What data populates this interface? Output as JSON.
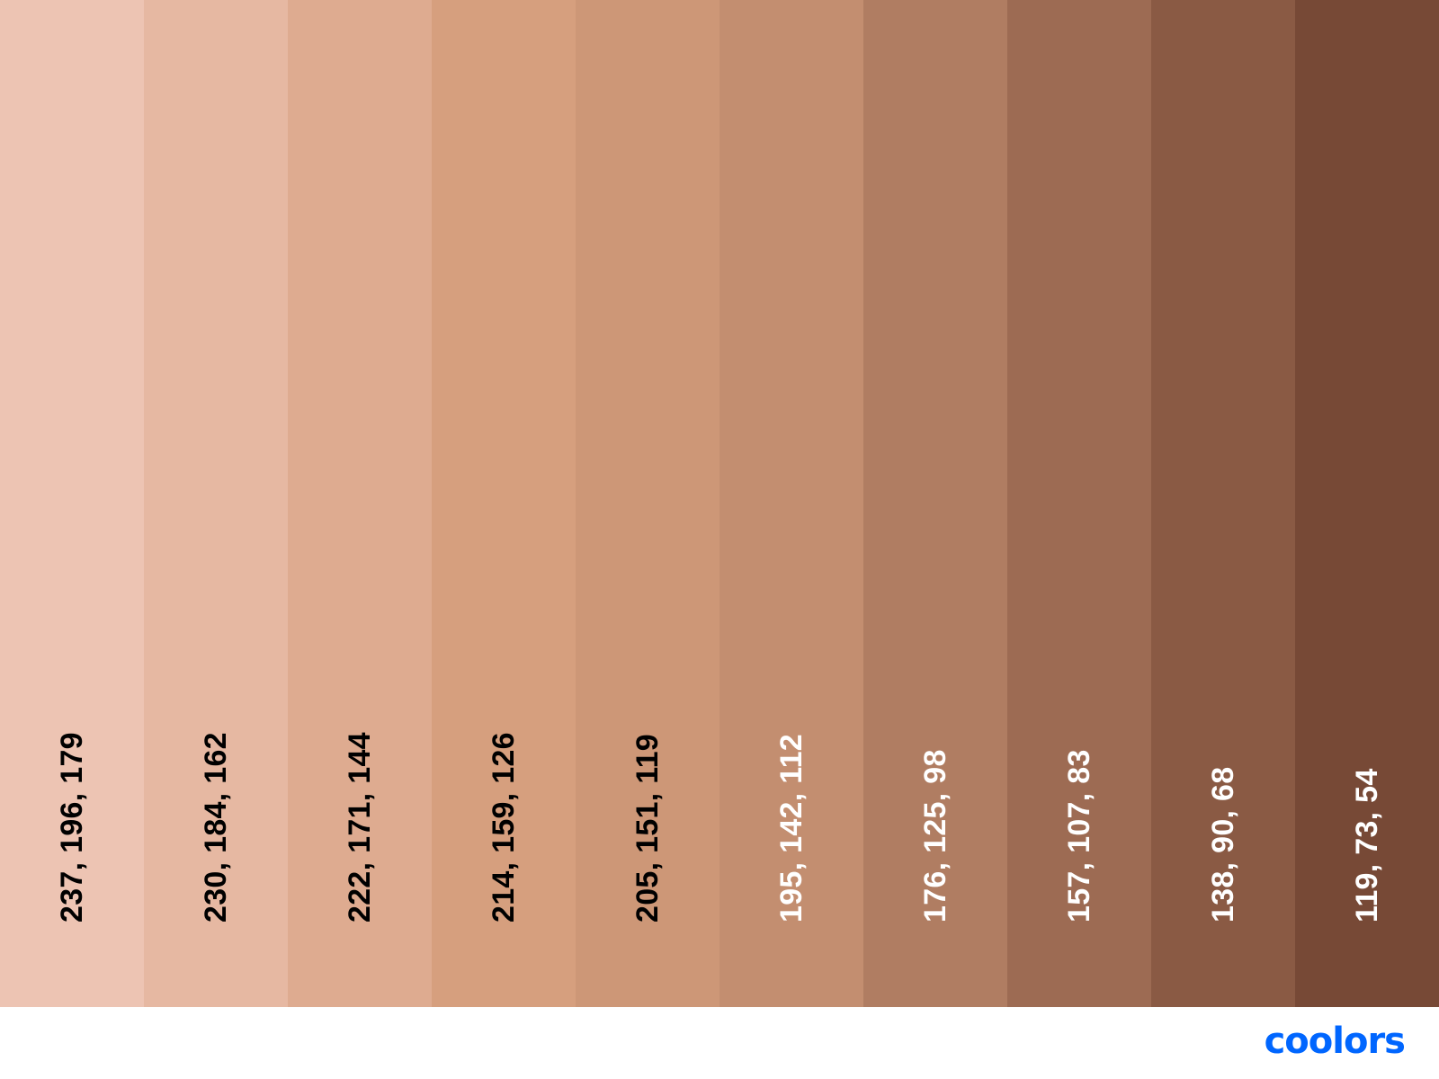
{
  "palette": {
    "swatches": [
      {
        "label": "237, 196, 179",
        "color": "#EDC4B3",
        "text_color": "#000000"
      },
      {
        "label": "230, 184, 162",
        "color": "#E6B8A2",
        "text_color": "#000000"
      },
      {
        "label": "222, 171, 144",
        "color": "#DEAB90",
        "text_color": "#000000"
      },
      {
        "label": "214, 159, 126",
        "color": "#D69F7E",
        "text_color": "#000000"
      },
      {
        "label": "205, 151, 119",
        "color": "#CD9777",
        "text_color": "#000000"
      },
      {
        "label": "195, 142, 112",
        "color": "#C38E70",
        "text_color": "#ffffff"
      },
      {
        "label": "176, 125, 98",
        "color": "#B07D62",
        "text_color": "#ffffff"
      },
      {
        "label": "157, 107, 83",
        "color": "#9D6B53",
        "text_color": "#ffffff"
      },
      {
        "label": "138, 90, 68",
        "color": "#8A5A44",
        "text_color": "#ffffff"
      },
      {
        "label": "119, 73, 54",
        "color": "#774936",
        "text_color": "#ffffff"
      }
    ]
  },
  "footer": {
    "logo_text": "coolors",
    "logo_color": "#0066FF"
  }
}
